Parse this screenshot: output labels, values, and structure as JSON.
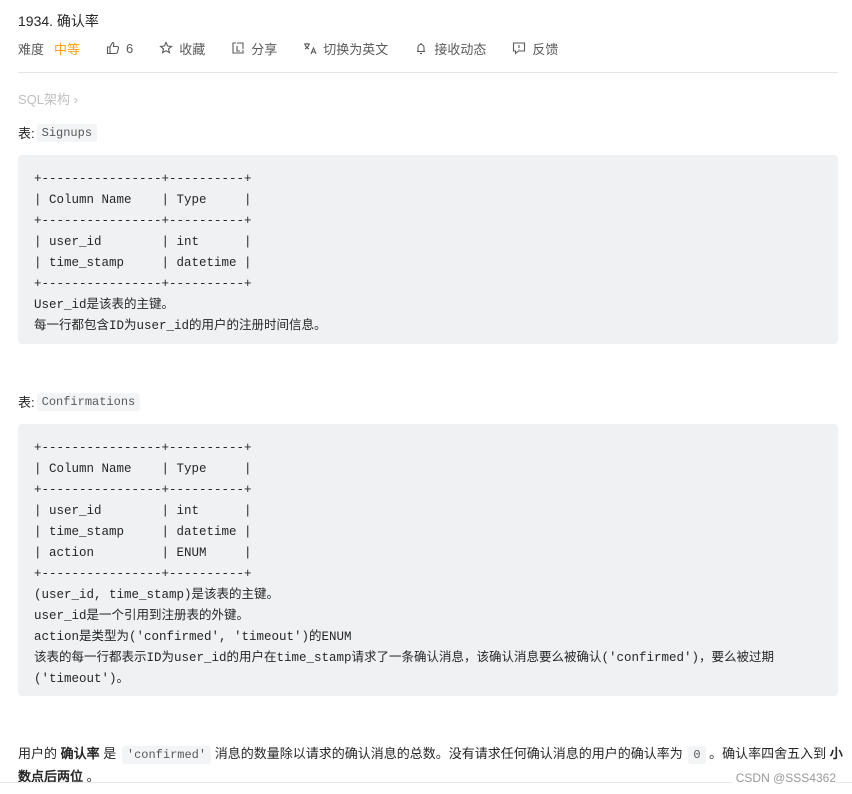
{
  "problem": {
    "title": "1934. 确认率",
    "difficulty_label": "难度",
    "difficulty": "中等",
    "difficulty_color": "#ffa116",
    "likes": "6",
    "actions": {
      "favorite": "收藏",
      "share": "分享",
      "switch_lang": "切换为英文",
      "subscribe": "接收动态",
      "feedback": "反馈"
    },
    "breadcrumb": "SQL架构 ›"
  },
  "tables": [
    {
      "label": "表:",
      "name": "Signups",
      "lines": [
        "+----------------+----------+",
        "| Column Name    | Type     |",
        "+----------------+----------+",
        "| user_id        | int      |",
        "| time_stamp     | datetime |",
        "+----------------+----------+",
        "User_id是该表的主键。",
        "每一行都包含ID为user_id的用户的注册时间信息。"
      ]
    },
    {
      "label": "表:",
      "name": "Confirmations",
      "lines": [
        "+----------------+----------+",
        "| Column Name    | Type     |",
        "+----------------+----------+",
        "| user_id        | int      |",
        "| time_stamp     | datetime |",
        "| action         | ENUM     |",
        "+----------------+----------+",
        "(user_id, time_stamp)是该表的主键。",
        "user_id是一个引用到注册表的外键。",
        "action是类型为('confirmed', 'timeout')的ENUM",
        "该表的每一行都表示ID为user_id的用户在time_stamp请求了一条确认消息，该确认消息要么被确认('confirmed')，要么被过期('timeout')。"
      ]
    }
  ],
  "description": {
    "p1": "用户的 ",
    "bold1": "确认率",
    "p2": " 是 ",
    "code1": "'confirmed'",
    "p3": " 消息的数量除以请求的确认消息的总数。没有请求任何确认消息的用户的确认率为 ",
    "code2": "0",
    "p4": " 。确认率四舍五入到 ",
    "bold2": "小数点后两位",
    "p5": " 。"
  },
  "watermark": "CSDN @SSS4362"
}
